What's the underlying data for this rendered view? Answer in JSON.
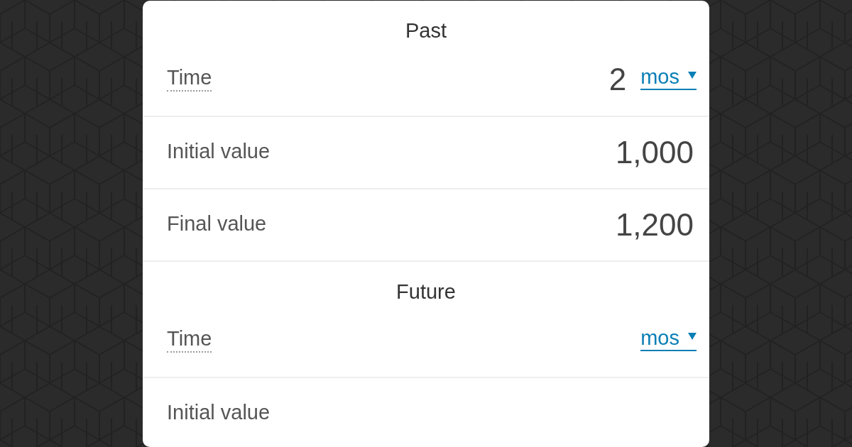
{
  "sections": [
    {
      "title": "Past",
      "rows": [
        {
          "kind": "time",
          "label": "Time",
          "value": "2",
          "unit": "mos"
        },
        {
          "kind": "number",
          "label": "Initial value",
          "value": "1,000"
        },
        {
          "kind": "number",
          "label": "Final value",
          "value": "1,200"
        }
      ]
    },
    {
      "title": "Future",
      "rows": [
        {
          "kind": "time",
          "label": "Time",
          "unit": "mos"
        },
        {
          "kind": "number",
          "label": "Initial value"
        }
      ]
    }
  ]
}
